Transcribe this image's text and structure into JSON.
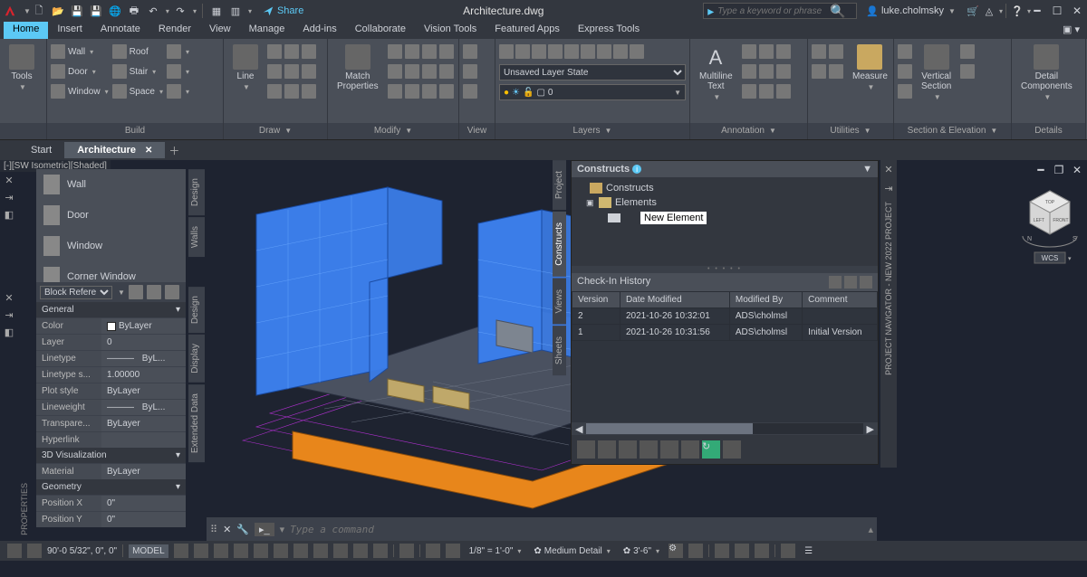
{
  "app": {
    "filename": "Architecture.dwg",
    "share": "Share",
    "search_placeholder": "Type a keyword or phrase",
    "username": "luke.cholmsky"
  },
  "menus": [
    "Home",
    "Insert",
    "Annotate",
    "Render",
    "View",
    "Manage",
    "Add-ins",
    "Collaborate",
    "Vision Tools",
    "Featured Apps",
    "Express Tools"
  ],
  "ribbon": {
    "panels": {
      "tools": "Tools",
      "build": "Build",
      "draw": "Draw",
      "modify": "Modify",
      "view": "View",
      "layers": "Layers",
      "annotation": "Annotation",
      "utilities": "Utilities",
      "section": "Section & Elevation",
      "details": "Details"
    },
    "build_items": {
      "wall": "Wall",
      "door": "Door",
      "window": "Window",
      "roof": "Roof",
      "stair": "Stair",
      "space": "Space"
    },
    "draw_line": "Line",
    "match_props": "Match\nProperties",
    "layer_state": "Unsaved Layer State",
    "layer_current": "0",
    "multiline_text": "Multiline\nText",
    "measure": "Measure",
    "vertical_section": "Vertical\nSection",
    "detail_components": "Detail\nComponents"
  },
  "doctabs": {
    "start": "Start",
    "arch": "Architecture"
  },
  "view_label": "[-][SW Isometric][Shaded]",
  "build_palette": [
    "Wall",
    "Door",
    "Window",
    "Corner Window"
  ],
  "side_tabs_left": [
    "Design",
    "Walls"
  ],
  "side_tabs_left2": [
    "Design",
    "Display",
    "Extended Data"
  ],
  "mid_tabs": [
    "Project",
    "Constructs",
    "Views",
    "Sheets"
  ],
  "properties": {
    "selector": "Block Refere...",
    "sections": {
      "general": "General",
      "viz": "3D Visualization",
      "geom": "Geometry"
    },
    "rows": {
      "color_k": "Color",
      "color_v": "ByLayer",
      "layer_k": "Layer",
      "layer_v": "0",
      "ltype_k": "Linetype",
      "ltype_v": "ByL...",
      "ltscale_k": "Linetype s...",
      "ltscale_v": "1.00000",
      "plot_k": "Plot style",
      "plot_v": "ByLayer",
      "lw_k": "Lineweight",
      "lw_v": "ByL...",
      "trans_k": "Transpare...",
      "trans_v": "ByLayer",
      "hyper_k": "Hyperlink",
      "hyper_v": "",
      "mat_k": "Material",
      "mat_v": "ByLayer",
      "px_k": "Position X",
      "px_v": "0\"",
      "py_k": "Position Y",
      "py_v": "0\""
    }
  },
  "navigator": {
    "title": "Constructs",
    "tree": {
      "root": "Constructs",
      "elements": "Elements",
      "new_element": "New Element"
    },
    "checkin_title": "Check-In History",
    "cols": {
      "ver": "Version",
      "date": "Date Modified",
      "by": "Modified By",
      "comment": "Comment"
    },
    "rows": [
      {
        "ver": "2",
        "date": "2021-10-26 10:32:01",
        "by": "ADS\\cholmsl",
        "comment": ""
      },
      {
        "ver": "1",
        "date": "2021-10-26 10:31:56",
        "by": "ADS\\cholmsl",
        "comment": "Initial Version"
      }
    ],
    "rail": "PROJECT NAVIGATOR - NEW 2022 PROJECT"
  },
  "cube": {
    "wcs": "WCS",
    "top": "TOP",
    "left": "LEFT",
    "front": "FRONT"
  },
  "cmd_placeholder": "Type a command",
  "status": {
    "coords": "90'-0 5/32\", 0\", 0\"",
    "model": "MODEL",
    "scale1": "1/8\" = 1'-0\"",
    "detail": "Medium Detail",
    "scale2": "3'-6\"",
    "gear": "✿"
  },
  "prop_label": "PROPERTIES"
}
